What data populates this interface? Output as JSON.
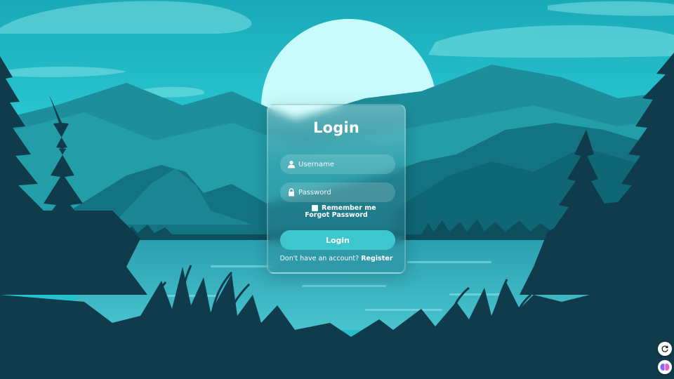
{
  "login_card": {
    "title": "Login",
    "username_placeholder": "Username",
    "password_placeholder": "Password",
    "remember_label": "Remember me",
    "forgot_label": "Forgot Password",
    "login_button_label": "Login",
    "signup_prompt": "Don't have an account?",
    "register_label": "Register"
  },
  "icons": {
    "username": "user-icon",
    "password": "lock-icon",
    "corner_top": "refresh-icon",
    "corner_bottom": "brain-icon"
  },
  "colors": {
    "sky_top": "#1fb5c2",
    "sky_glow": "#35e0e4",
    "moon": "#c8fbfb",
    "mountain_far": "#1f8f9c",
    "mountain_mid": "#15707d",
    "lake": "#3fb7c6",
    "foreground": "#0f3b4a",
    "button": "#3fc7d0"
  }
}
